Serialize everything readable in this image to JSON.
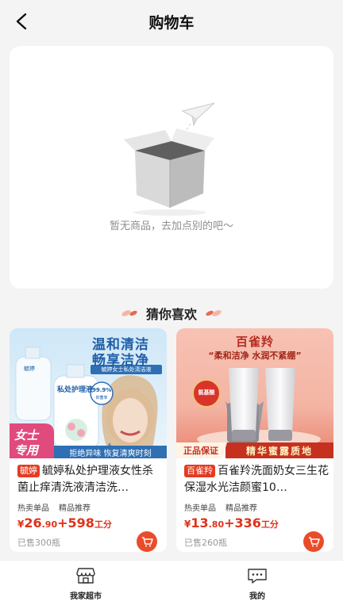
{
  "header": {
    "title": "购物车"
  },
  "empty": {
    "message": "暂无商品，去加点别的吧～"
  },
  "recommend": {
    "title": "猜你喜欢"
  },
  "products": [
    {
      "brand_tag": "毓婷",
      "name": "毓婷私处护理液女性杀菌止痒清洗液清洁洗…",
      "tags": [
        "热卖单品",
        "精品推荐"
      ],
      "price_currency": "¥",
      "price_int": "26",
      "price_dec": ".90",
      "points": "+598",
      "points_unit": "工分",
      "sold": "已售300瓶",
      "image": {
        "headline1": "温和清洁",
        "headline2": "畅享洁净",
        "sub_banner": "毓婷女士私处清洁液",
        "bottle_brand": "毓婷",
        "bottle_label": "私处护理液",
        "badge": "99.9%",
        "badge_sub": "抑菌率",
        "corner_text1": "女士",
        "corner_text2": "专用",
        "bottom_banner": "拒绝异味 恢复清爽时刻"
      }
    },
    {
      "brand_tag": "百雀羚",
      "name": "百雀羚洗面奶女三生花保湿水光洁颜蜜10…",
      "tags": [
        "热卖单品",
        "精品推荐"
      ],
      "price_currency": "¥",
      "price_int": "13",
      "price_dec": ".80",
      "points": "+336",
      "points_unit": "工分",
      "sold": "已售260瓶",
      "image": {
        "logo": "百雀羚",
        "slogan": "“柔和洁净 水润不紧绷”",
        "seal": "氨基酸",
        "guarantee": "正品保证",
        "bottom_banner": "精华蜜露质地"
      }
    }
  ],
  "tabbar": {
    "items": [
      {
        "label": "我家超市",
        "icon": "store-icon"
      },
      {
        "label": "我的",
        "icon": "chat-icon"
      }
    ]
  },
  "colors": {
    "accent": "#e0321a",
    "cart": "#ea4c2a",
    "background": "#f4f4f4"
  }
}
